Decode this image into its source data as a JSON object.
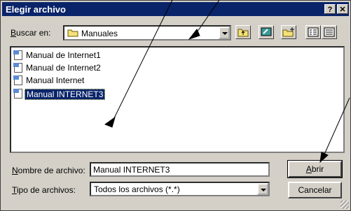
{
  "window": {
    "title": "Elegir archivo",
    "help_label": "?",
    "close_label": "✕"
  },
  "lookin": {
    "label_u": "B",
    "label_rest": "uscar en:",
    "value": "Manuales"
  },
  "toolbar": {
    "buttons": [
      "up-folder",
      "desktop",
      "new-folder",
      "list-view",
      "details-view"
    ]
  },
  "files": [
    {
      "name": "Manual de Internet1",
      "selected": false
    },
    {
      "name": "Manual de Internet2",
      "selected": false
    },
    {
      "name": "Manual Internet",
      "selected": false
    },
    {
      "name": "Manual INTERNET3",
      "selected": true
    }
  ],
  "filename": {
    "label_u": "N",
    "label_rest": "ombre de archivo:",
    "value": "Manual INTERNET3"
  },
  "filetype": {
    "label_u": "T",
    "label_rest": "ipo de archivos:",
    "value": "Todos los archivos (*.*)"
  },
  "buttons": {
    "open_u": "A",
    "open_rest": "brir",
    "cancel": "Cancelar"
  }
}
